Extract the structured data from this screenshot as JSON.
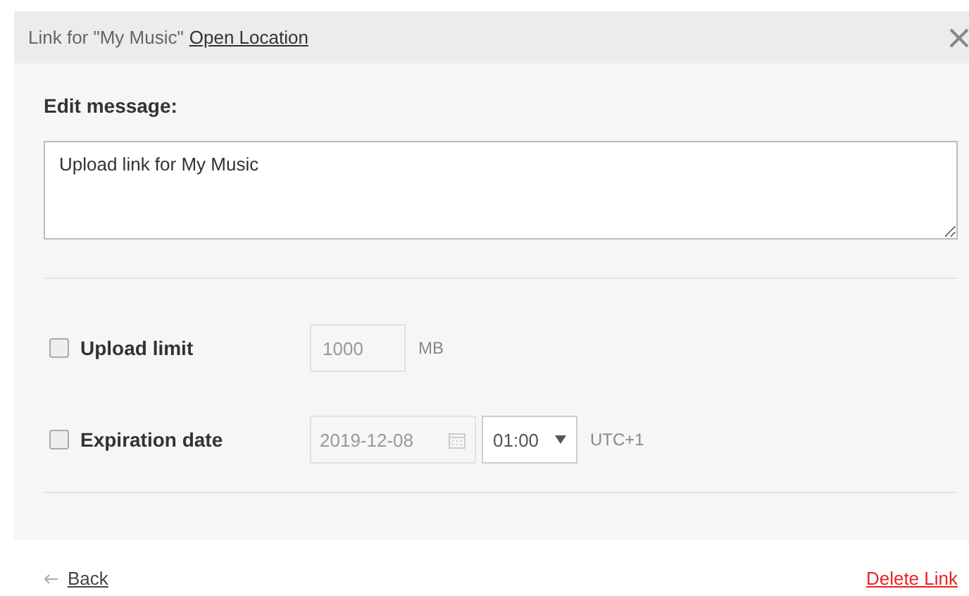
{
  "header": {
    "title": "Link for \"My Music\"",
    "link": "Open Location"
  },
  "message": {
    "label": "Edit message:",
    "value": "Upload link for My Music"
  },
  "options": [
    {
      "kind": "limit",
      "label": "Upload limit",
      "checked": false,
      "value": "1000",
      "unit": "MB"
    },
    {
      "kind": "expiry",
      "label": "Expiration date",
      "checked": false,
      "date": "2019-12-08",
      "time": "01:00",
      "timezone": "UTC+1"
    }
  ],
  "footer": {
    "back": "Back",
    "delete": "Delete Link"
  }
}
